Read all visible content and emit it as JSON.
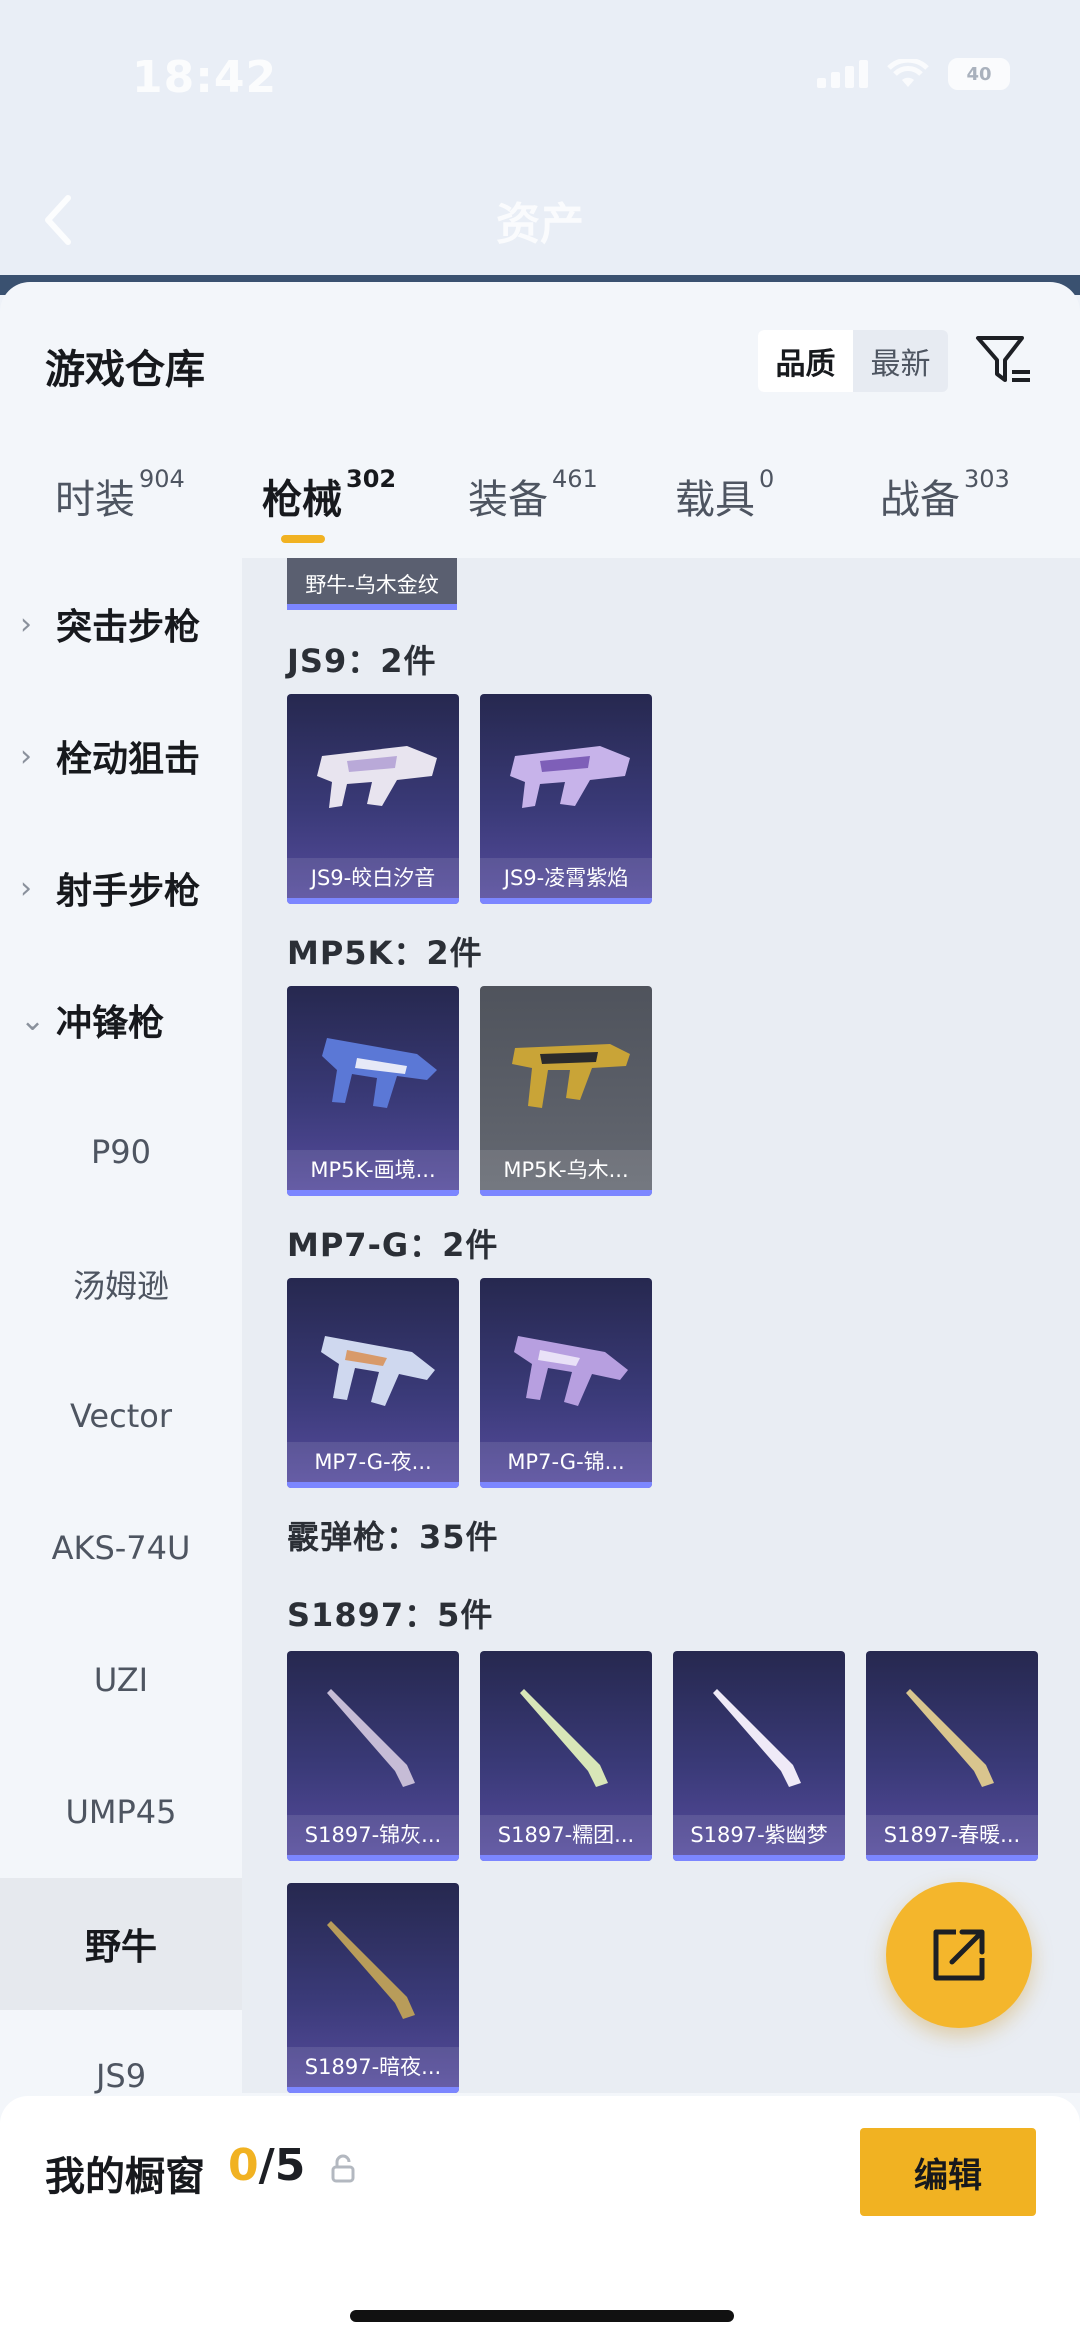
{
  "status_bar": {
    "time": "18:42",
    "battery": "40"
  },
  "header": {
    "title": "资产"
  },
  "sheet": {
    "title": "游戏仓库",
    "sort_options": [
      "品质",
      "最新"
    ],
    "sort_active": "品质"
  },
  "tabs": [
    {
      "label": "时装",
      "count": "904"
    },
    {
      "label": "枪械",
      "count": "302"
    },
    {
      "label": "装备",
      "count": "461"
    },
    {
      "label": "载具",
      "count": "0"
    },
    {
      "label": "战备",
      "count": "303"
    }
  ],
  "sidebar": {
    "categories": [
      {
        "label": "突击步枪",
        "expanded": false
      },
      {
        "label": "栓动狙击",
        "expanded": false
      },
      {
        "label": "射手步枪",
        "expanded": false
      },
      {
        "label": "冲锋枪",
        "expanded": true
      }
    ],
    "sub_items": [
      {
        "label": "P90"
      },
      {
        "label": "汤姆逊"
      },
      {
        "label": "Vector"
      },
      {
        "label": "AKS-74U"
      },
      {
        "label": "UZI"
      },
      {
        "label": "UMP45"
      },
      {
        "label": "野牛",
        "active": true
      },
      {
        "label": "JS9"
      }
    ]
  },
  "content": {
    "top_chip": "野牛-乌木金纹",
    "groups": [
      {
        "label": "JS9：2件",
        "items": [
          "JS9-皎白汐音",
          "JS9-凌霄紫焰"
        ]
      },
      {
        "label": "MP5K：2件",
        "items": [
          "MP5K-画境...",
          "MP5K-乌木..."
        ]
      },
      {
        "label": "MP7-G：2件",
        "items": [
          "MP7-G-夜...",
          "MP7-G-锦..."
        ]
      },
      {
        "label": "霰弹枪：35件",
        "items": []
      },
      {
        "label": "S1897：5件",
        "items": [
          "S1897-锦灰...",
          "S1897-糯团...",
          "S1897-紫幽梦",
          "S1897-春暖...",
          "S1897-暗夜..."
        ]
      }
    ]
  },
  "bottom": {
    "label": "我的橱窗",
    "count_current": "0",
    "count_total": "/5",
    "edit_label": "编辑"
  },
  "colors": {
    "accent": "#f1b222",
    "card_purple": "#3a3a78",
    "card_bar": "#7c86ff"
  }
}
